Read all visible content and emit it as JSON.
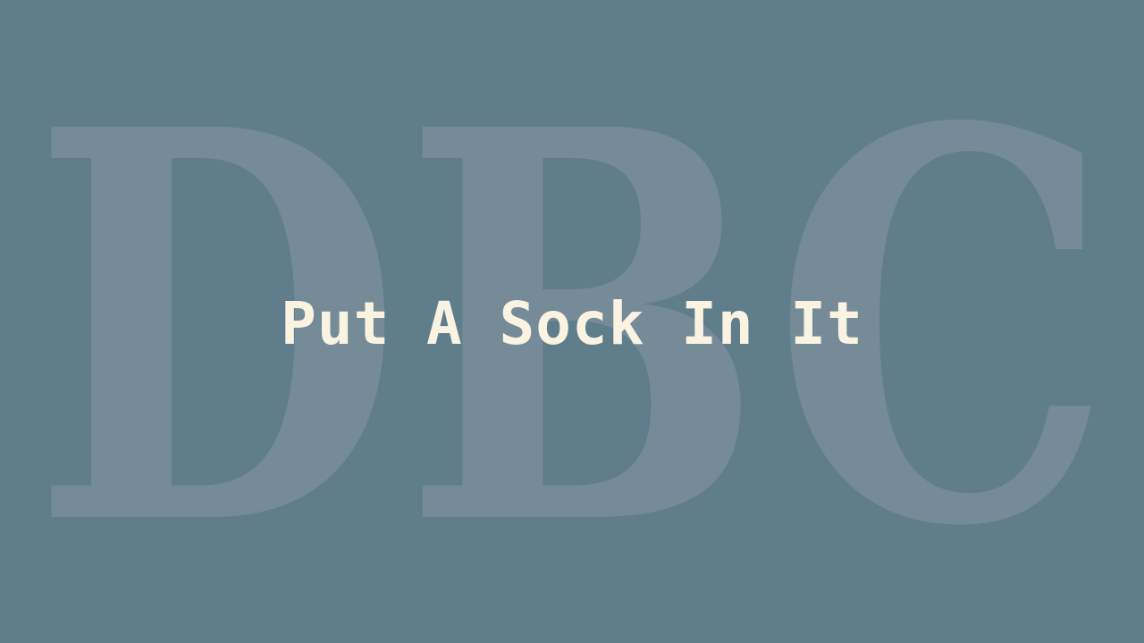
{
  "logo": {
    "text": "DBC",
    "color": "#758b98"
  },
  "title": "Put A Sock In It",
  "colors": {
    "background": "#607d8c",
    "title": "#fbf3e2"
  }
}
